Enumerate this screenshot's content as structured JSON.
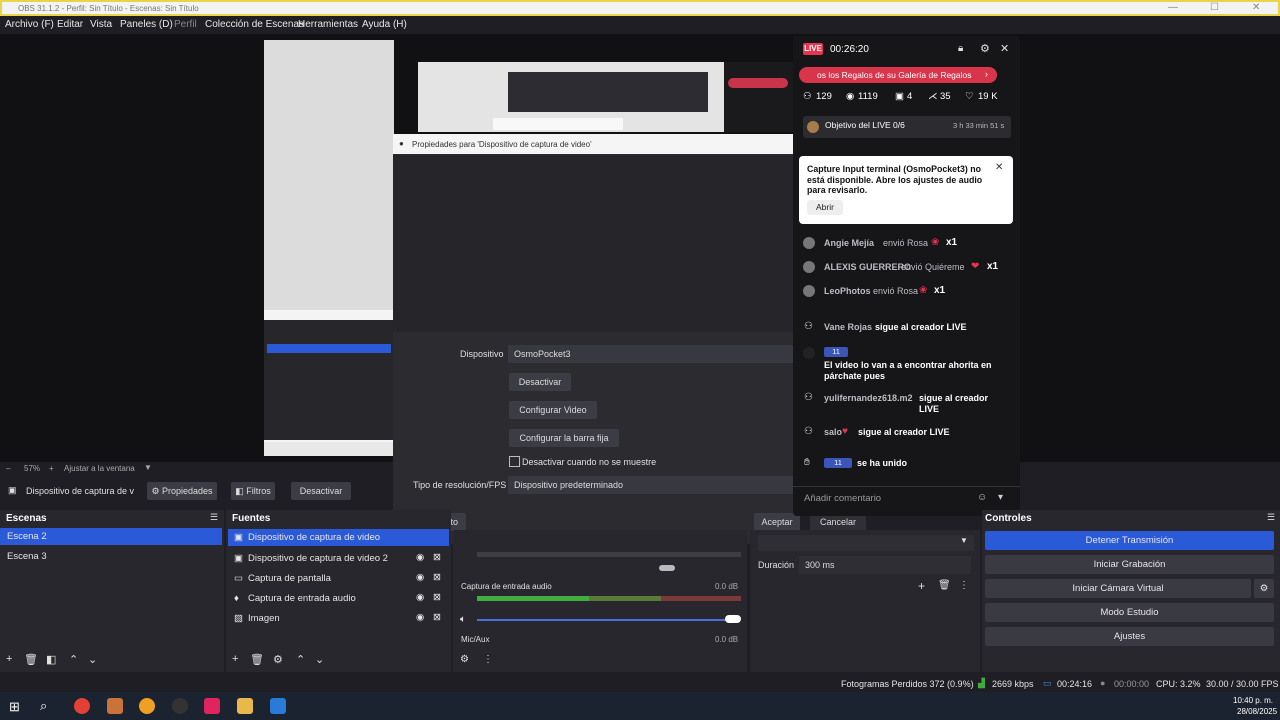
{
  "window": {
    "title": "OBS 31.1.2 - Perfil: Sin Título - Escenas: Sin Título"
  },
  "menu": [
    "Archivo (F)",
    "Editar",
    "Vista",
    "Paneles (D)",
    "Perfil",
    "Colección de Escenas",
    "Herramientas",
    "Ayuda (H)"
  ],
  "preview": {
    "zoom": "57%",
    "fit_label": "Ajustar a la ventana"
  },
  "source_toolbar": {
    "source_name": "Dispositivo de captura de v",
    "properties": "Propiedades",
    "filters": "Filtros",
    "deactivate": "Desactivar"
  },
  "dialog": {
    "title": "Propiedades para 'Dispositivo de captura de video'",
    "device_label": "Dispositivo",
    "device_value": "OsmoPocket3",
    "btn_deactivate": "Desactivar",
    "btn_config_video": "Configurar Video",
    "btn_config_bar": "Configurar la barra fija",
    "checkbox_label": "Desactivar cuando no se muestre",
    "res_label": "Tipo de resolución/FPS",
    "res_value": "Dispositivo predeterminado",
    "btn_default": "Por defecto",
    "btn_accept": "Aceptar",
    "btn_cancel": "Cancelar"
  },
  "live": {
    "badge": "LIVE",
    "time": "00:26:20",
    "banner": "os los Regalos de su Galería de Regalos",
    "stats": {
      "viewers": "129",
      "views": "1119",
      "gifts": "4",
      "shares": "35",
      "likes": "19 K"
    },
    "objective": "Objetivo del LIVE 0/6",
    "objective_time": "3 h 33 min 51 s",
    "notice": "Capture Input terminal (OsmoPocket3) no está disponible. Abre los ajustes de audio para revisarlo.",
    "notice_btn": "Abrir",
    "chat": [
      {
        "name": "Angie Mejía",
        "text": "envió Rosa",
        "count": "x1"
      },
      {
        "name": "ALEXIS GUERRERO",
        "text": "envió Quiéreme",
        "count": "x1"
      },
      {
        "name": "LeoPhotos",
        "text": "envió Rosa",
        "count": "x1"
      },
      {
        "name": "Vane Rojas",
        "text": "sigue al creador LIVE",
        "count": ""
      },
      {
        "name": "11",
        "text": "El video lo van a a encontrar ahorita en párchate pues",
        "count": ""
      },
      {
        "name": "yulifernandez618.m2",
        "text": "sigue al creador LIVE",
        "count": ""
      },
      {
        "name": "salo",
        "text": "sigue al creador LIVE",
        "count": ""
      },
      {
        "name": "11",
        "text": "se ha unido",
        "count": ""
      }
    ],
    "comment_placeholder": "Añadir comentario"
  },
  "scenes": {
    "header": "Escenas",
    "items": [
      "Escena 2",
      "Escena 3"
    ]
  },
  "sources": {
    "header": "Fuentes",
    "items": [
      "Dispositivo de captura de video",
      "Dispositivo de captura de video 2",
      "Captura de pantalla",
      "Captura de entrada audio",
      "Imagen"
    ]
  },
  "mixer": {
    "ch1_label": "Captura de entrada audio",
    "ch1_db": "0.0 dB",
    "ch2_label": "Mic/Aux",
    "ch2_db": "0.0 dB"
  },
  "transitions": {
    "duration_label": "Duración",
    "duration_value": "300 ms"
  },
  "controls": {
    "header": "Controles",
    "buttons": [
      "Detener Transmisión",
      "Iniciar Grabación",
      "Iniciar Cámara Virtual",
      "Modo Estudio",
      "Ajustes"
    ]
  },
  "status": {
    "dropped": "Fotogramas Perdidos 372 (0.9%)",
    "bitrate": "2669 kbps",
    "stream_time": "00:24:16",
    "rec_time": "00:00:00",
    "cpu": "CPU: 3.2%",
    "fps": "30.00 / 30.00 FPS"
  },
  "clock": {
    "time": "10:40 p. m.",
    "date": "28/08/2025"
  },
  "colors": {
    "accent": "#2a5ad8",
    "live_red": "#e8344e",
    "status_green": "#3fae3f"
  }
}
